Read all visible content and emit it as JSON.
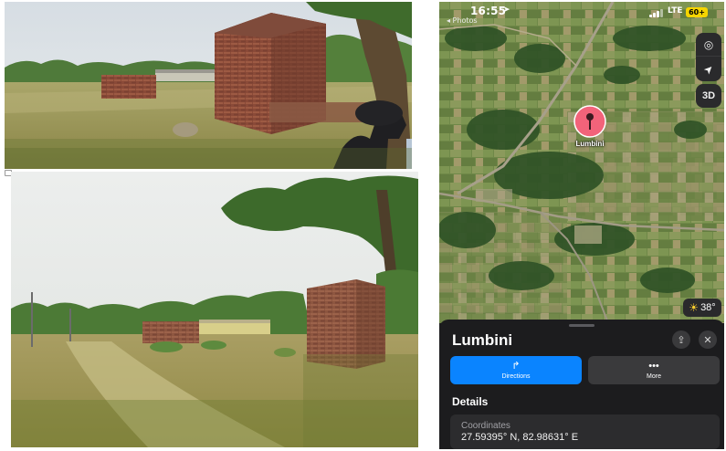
{
  "status_bar": {
    "time": "16:55",
    "location_arrow": "➤",
    "back_label": "◂ Photos",
    "network": "LTE",
    "battery": "60+"
  },
  "map": {
    "pin_label": "Lumbini",
    "controls": {
      "globe_icon": "◎",
      "locate_icon": "➤",
      "view_3d": "3D"
    },
    "weather": {
      "icon": "☀",
      "temperature": "38°"
    }
  },
  "sheet": {
    "title": "Lumbini",
    "share_icon": "⇪",
    "close_icon": "✕",
    "directions": {
      "icon": "↱",
      "label": "Directions"
    },
    "more": {
      "icon": "•••",
      "label": "More"
    },
    "details_heading": "Details",
    "coordinates_label": "Coordinates",
    "coordinates_value": "27.59395° N, 82.98631° E"
  },
  "colors": {
    "accent_blue": "#0a84ff",
    "pin_pink": "#f2637a",
    "battery_yellow": "#f5d400",
    "sheet_bg": "#1c1c1e"
  }
}
